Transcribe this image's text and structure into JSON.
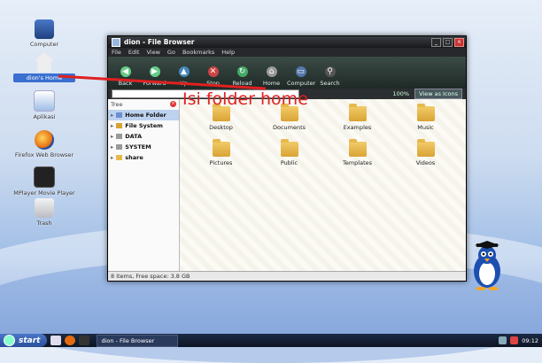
{
  "desktop": {
    "icons": [
      {
        "label": "Computer",
        "icon": "computer-icon"
      },
      {
        "label": "dion's Home",
        "icon": "home-icon"
      },
      {
        "label": "Aplikasi",
        "icon": "applications-icon"
      },
      {
        "label": "Firefox Web Browser",
        "icon": "firefox-icon"
      },
      {
        "label": "MPlayer Movie Player",
        "icon": "mplayer-icon"
      },
      {
        "label": "Trash",
        "icon": "trash-icon"
      }
    ]
  },
  "window": {
    "title": "dion - File Browser",
    "menu": [
      "File",
      "Edit",
      "View",
      "Go",
      "Bookmarks",
      "Help"
    ],
    "toolbar": [
      {
        "label": "Back",
        "icon": "back-arrow-icon"
      },
      {
        "label": "Forward",
        "icon": "forward-arrow-icon"
      },
      {
        "label": "Up",
        "icon": "up-arrow-icon"
      },
      {
        "label": "Stop",
        "icon": "stop-icon"
      },
      {
        "label": "Reload",
        "icon": "reload-icon"
      },
      {
        "label": "Home",
        "icon": "home-icon"
      },
      {
        "label": "Computer",
        "icon": "computer-icon"
      },
      {
        "label": "Search",
        "icon": "search-icon"
      }
    ],
    "zoom": "100%",
    "view_as": "View as Icons",
    "sidebar": {
      "title": "Tree",
      "items": [
        {
          "label": "Home Folder",
          "selected": true
        },
        {
          "label": "File System"
        },
        {
          "label": "DATA"
        },
        {
          "label": "SYSTEM"
        },
        {
          "label": "share"
        }
      ]
    },
    "files": [
      "Desktop",
      "Documents",
      "Examples",
      "Music",
      "Pictures",
      "Public",
      "Templates",
      "Videos"
    ],
    "status": "8 items, Free space: 3.8 GB"
  },
  "annotation": "Isi folder home",
  "taskbar": {
    "start_label": "start",
    "task_label": "dion - File Browser",
    "clock": "09:12"
  },
  "colors": {
    "annotation": "#e02020",
    "selection": "#3a6fd0",
    "folder": "#e7b94d"
  }
}
